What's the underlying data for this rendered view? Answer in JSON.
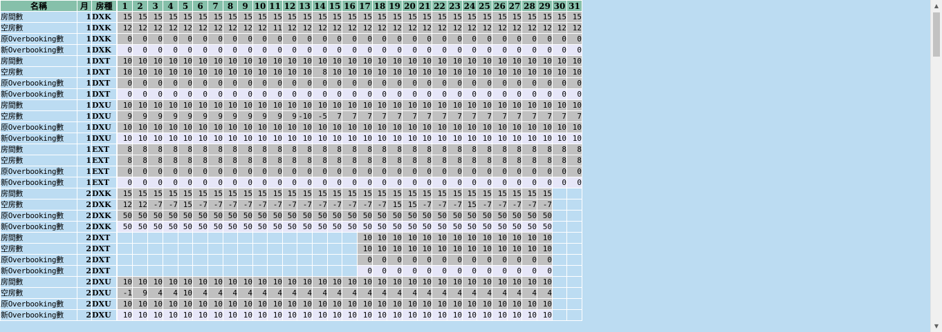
{
  "header": {
    "name": "名稱",
    "month": "月",
    "room": "房種",
    "days": [
      "1",
      "2",
      "3",
      "4",
      "5",
      "6",
      "7",
      "8",
      "9",
      "10",
      "11",
      "12",
      "13",
      "14",
      "15",
      "16",
      "17",
      "18",
      "19",
      "20",
      "21",
      "22",
      "23",
      "24",
      "25",
      "26",
      "27",
      "28",
      "29",
      "30",
      "31"
    ]
  },
  "rows": [
    {
      "name": "房間數",
      "month": "1",
      "room": "DXK",
      "values": [
        "15",
        "15",
        "15",
        "15",
        "15",
        "15",
        "15",
        "15",
        "15",
        "15",
        "15",
        "15",
        "15",
        "15",
        "15",
        "15",
        "15",
        "15",
        "15",
        "15",
        "15",
        "15",
        "15",
        "15",
        "15",
        "15",
        "15",
        "15",
        "15",
        "15",
        "15"
      ]
    },
    {
      "name": "空房數",
      "month": "1",
      "room": "DXK",
      "values": [
        "12",
        "12",
        "12",
        "12",
        "12",
        "12",
        "12",
        "12",
        "12",
        "12",
        "11",
        "12",
        "12",
        "12",
        "12",
        "12",
        "12",
        "12",
        "12",
        "12",
        "12",
        "12",
        "12",
        "12",
        "12",
        "12",
        "12",
        "12",
        "12",
        "12",
        "12"
      ]
    },
    {
      "name": "原Overbooking數",
      "month": "1",
      "room": "DXK",
      "values": [
        "0",
        "0",
        "0",
        "0",
        "0",
        "0",
        "0",
        "0",
        "0",
        "0",
        "0",
        "0",
        "0",
        "0",
        "0",
        "0",
        "0",
        "0",
        "0",
        "0",
        "0",
        "0",
        "0",
        "0",
        "0",
        "0",
        "0",
        "0",
        "0",
        "0",
        "0"
      ]
    },
    {
      "name": "新Overbooking數",
      "month": "1",
      "room": "DXK",
      "values": [
        "0",
        "0",
        "0",
        "0",
        "0",
        "0",
        "0",
        "0",
        "0",
        "0",
        "0",
        "0",
        "0",
        "0",
        "0",
        "0",
        "0",
        "0",
        "0",
        "0",
        "0",
        "0",
        "0",
        "0",
        "0",
        "0",
        "0",
        "0",
        "0",
        "0",
        "0"
      ]
    },
    {
      "name": "房間數",
      "month": "1",
      "room": "DXT",
      "values": [
        "10",
        "10",
        "10",
        "10",
        "10",
        "10",
        "10",
        "10",
        "10",
        "10",
        "10",
        "10",
        "10",
        "10",
        "10",
        "10",
        "10",
        "10",
        "10",
        "10",
        "10",
        "10",
        "10",
        "10",
        "10",
        "10",
        "10",
        "10",
        "10",
        "10",
        "10"
      ]
    },
    {
      "name": "空房數",
      "month": "1",
      "room": "DXT",
      "values": [
        "10",
        "10",
        "10",
        "10",
        "10",
        "10",
        "10",
        "10",
        "10",
        "10",
        "10",
        "10",
        "10",
        "8",
        "10",
        "10",
        "10",
        "10",
        "10",
        "10",
        "10",
        "10",
        "10",
        "10",
        "10",
        "10",
        "10",
        "10",
        "10",
        "10",
        "10"
      ]
    },
    {
      "name": "原Overbooking數",
      "month": "1",
      "room": "DXT",
      "values": [
        "0",
        "0",
        "0",
        "0",
        "0",
        "0",
        "0",
        "0",
        "0",
        "0",
        "0",
        "0",
        "0",
        "0",
        "0",
        "0",
        "0",
        "0",
        "0",
        "0",
        "0",
        "0",
        "0",
        "0",
        "0",
        "0",
        "0",
        "0",
        "0",
        "0",
        "0"
      ]
    },
    {
      "name": "新Overbooking數",
      "month": "1",
      "room": "DXT",
      "values": [
        "0",
        "0",
        "0",
        "0",
        "0",
        "0",
        "0",
        "0",
        "0",
        "0",
        "0",
        "0",
        "0",
        "0",
        "0",
        "0",
        "0",
        "0",
        "0",
        "0",
        "0",
        "0",
        "0",
        "0",
        "0",
        "0",
        "0",
        "0",
        "0",
        "0",
        "0"
      ]
    },
    {
      "name": "房間數",
      "month": "1",
      "room": "DXU",
      "values": [
        "10",
        "10",
        "10",
        "10",
        "10",
        "10",
        "10",
        "10",
        "10",
        "10",
        "10",
        "10",
        "10",
        "10",
        "10",
        "10",
        "10",
        "10",
        "10",
        "10",
        "10",
        "10",
        "10",
        "10",
        "10",
        "10",
        "10",
        "10",
        "10",
        "10",
        "10"
      ]
    },
    {
      "name": "空房數",
      "month": "1",
      "room": "DXU",
      "values": [
        "9",
        "9",
        "9",
        "9",
        "9",
        "9",
        "9",
        "9",
        "9",
        "9",
        "9",
        "9",
        "-10",
        "-5",
        "7",
        "7",
        "7",
        "7",
        "7",
        "7",
        "7",
        "7",
        "7",
        "7",
        "7",
        "7",
        "7",
        "7",
        "7",
        "7",
        "7"
      ]
    },
    {
      "name": "原Overbooking數",
      "month": "1",
      "room": "DXU",
      "values": [
        "10",
        "10",
        "10",
        "10",
        "10",
        "10",
        "10",
        "10",
        "10",
        "10",
        "10",
        "10",
        "10",
        "10",
        "10",
        "10",
        "10",
        "10",
        "10",
        "10",
        "10",
        "10",
        "10",
        "10",
        "10",
        "10",
        "10",
        "10",
        "10",
        "10",
        "10"
      ]
    },
    {
      "name": "新Overbooking數",
      "month": "1",
      "room": "DXU",
      "values": [
        "10",
        "10",
        "10",
        "10",
        "10",
        "10",
        "10",
        "10",
        "10",
        "10",
        "10",
        "10",
        "10",
        "10",
        "10",
        "10",
        "10",
        "10",
        "10",
        "10",
        "10",
        "10",
        "10",
        "10",
        "10",
        "10",
        "10",
        "10",
        "10",
        "10",
        "10"
      ]
    },
    {
      "name": "房間數",
      "month": "1",
      "room": "EXT",
      "values": [
        "8",
        "8",
        "8",
        "8",
        "8",
        "8",
        "8",
        "8",
        "8",
        "8",
        "8",
        "8",
        "8",
        "8",
        "8",
        "8",
        "8",
        "8",
        "8",
        "8",
        "8",
        "8",
        "8",
        "8",
        "8",
        "8",
        "8",
        "8",
        "8",
        "8",
        "8"
      ]
    },
    {
      "name": "空房數",
      "month": "1",
      "room": "EXT",
      "values": [
        "8",
        "8",
        "8",
        "8",
        "8",
        "8",
        "8",
        "8",
        "8",
        "8",
        "8",
        "8",
        "8",
        "8",
        "8",
        "8",
        "8",
        "8",
        "8",
        "8",
        "8",
        "8",
        "8",
        "8",
        "8",
        "8",
        "8",
        "8",
        "8",
        "8",
        "8"
      ]
    },
    {
      "name": "原Overbooking數",
      "month": "1",
      "room": "EXT",
      "values": [
        "0",
        "0",
        "0",
        "0",
        "0",
        "0",
        "0",
        "0",
        "0",
        "0",
        "0",
        "0",
        "0",
        "0",
        "0",
        "0",
        "0",
        "0",
        "0",
        "0",
        "0",
        "0",
        "0",
        "0",
        "0",
        "0",
        "0",
        "0",
        "0",
        "0",
        "0"
      ]
    },
    {
      "name": "新Overbooking數",
      "month": "1",
      "room": "EXT",
      "values": [
        "0",
        "0",
        "0",
        "0",
        "0",
        "0",
        "0",
        "0",
        "0",
        "0",
        "0",
        "0",
        "0",
        "0",
        "0",
        "0",
        "0",
        "0",
        "0",
        "0",
        "0",
        "0",
        "0",
        "0",
        "0",
        "0",
        "0",
        "0",
        "0",
        "0",
        "0"
      ]
    },
    {
      "name": "房間數",
      "month": "2",
      "room": "DXK",
      "values": [
        "15",
        "15",
        "15",
        "15",
        "15",
        "15",
        "15",
        "15",
        "15",
        "15",
        "15",
        "15",
        "15",
        "15",
        "15",
        "15",
        "15",
        "15",
        "15",
        "15",
        "15",
        "15",
        "15",
        "15",
        "15",
        "15",
        "15",
        "15",
        "15",
        "",
        ""
      ]
    },
    {
      "name": "空房數",
      "month": "2",
      "room": "DXK",
      "values": [
        "12",
        "12",
        "-7",
        "-7",
        "15",
        "-7",
        "-7",
        "-7",
        "-7",
        "-7",
        "-7",
        "-7",
        "-7",
        "-7",
        "-7",
        "-7",
        "-7",
        "-7",
        "15",
        "15",
        "-7",
        "-7",
        "-7",
        "15",
        "-7",
        "-7",
        "-7",
        "-7",
        "-7",
        "",
        ""
      ]
    },
    {
      "name": "原Overbooking數",
      "month": "2",
      "room": "DXK",
      "values": [
        "50",
        "50",
        "50",
        "50",
        "50",
        "50",
        "50",
        "50",
        "50",
        "50",
        "50",
        "50",
        "50",
        "50",
        "50",
        "50",
        "50",
        "50",
        "50",
        "50",
        "50",
        "50",
        "50",
        "50",
        "50",
        "50",
        "50",
        "50",
        "50",
        "",
        ""
      ]
    },
    {
      "name": "新Overbooking數",
      "month": "2",
      "room": "DXK",
      "values": [
        "50",
        "50",
        "50",
        "50",
        "50",
        "50",
        "50",
        "50",
        "50",
        "50",
        "50",
        "50",
        "50",
        "50",
        "50",
        "50",
        "50",
        "50",
        "50",
        "50",
        "50",
        "50",
        "50",
        "50",
        "50",
        "50",
        "50",
        "50",
        "50",
        "",
        ""
      ]
    },
    {
      "name": "房間數",
      "month": "2",
      "room": "DXT",
      "values": [
        "",
        "",
        "",
        "",
        "",
        "",
        "",
        "",
        "",
        "",
        "",
        "",
        "",
        "",
        "",
        "",
        "10",
        "10",
        "10",
        "10",
        "10",
        "10",
        "10",
        "10",
        "10",
        "10",
        "10",
        "10",
        "10",
        "",
        ""
      ]
    },
    {
      "name": "空房數",
      "month": "2",
      "room": "DXT",
      "values": [
        "",
        "",
        "",
        "",
        "",
        "",
        "",
        "",
        "",
        "",
        "",
        "",
        "",
        "",
        "",
        "",
        "10",
        "10",
        "10",
        "10",
        "10",
        "10",
        "10",
        "10",
        "10",
        "10",
        "10",
        "10",
        "10",
        "",
        ""
      ]
    },
    {
      "name": "原Overbooking數",
      "month": "2",
      "room": "DXT",
      "values": [
        "",
        "",
        "",
        "",
        "",
        "",
        "",
        "",
        "",
        "",
        "",
        "",
        "",
        "",
        "",
        "",
        "0",
        "0",
        "0",
        "0",
        "0",
        "0",
        "0",
        "0",
        "0",
        "0",
        "0",
        "0",
        "0",
        "",
        ""
      ]
    },
    {
      "name": "新Overbooking數",
      "month": "2",
      "room": "DXT",
      "values": [
        "",
        "",
        "",
        "",
        "",
        "",
        "",
        "",
        "",
        "",
        "",
        "",
        "",
        "",
        "",
        "",
        "0",
        "0",
        "0",
        "0",
        "0",
        "0",
        "0",
        "0",
        "0",
        "0",
        "0",
        "0",
        "0",
        "",
        ""
      ]
    },
    {
      "name": "房間數",
      "month": "2",
      "room": "DXU",
      "values": [
        "10",
        "10",
        "10",
        "10",
        "10",
        "10",
        "10",
        "10",
        "10",
        "10",
        "10",
        "10",
        "10",
        "10",
        "10",
        "10",
        "10",
        "10",
        "10",
        "10",
        "10",
        "10",
        "10",
        "10",
        "10",
        "10",
        "10",
        "10",
        "10",
        "",
        ""
      ]
    },
    {
      "name": "空房數",
      "month": "2",
      "room": "DXU",
      "values": [
        "-1",
        "9",
        "4",
        "4",
        "10",
        "4",
        "4",
        "4",
        "4",
        "4",
        "4",
        "4",
        "4",
        "4",
        "4",
        "4",
        "4",
        "4",
        "4",
        "4",
        "4",
        "4",
        "4",
        "4",
        "4",
        "4",
        "4",
        "4",
        "4",
        "",
        ""
      ]
    },
    {
      "name": "原Overbooking數",
      "month": "2",
      "room": "DXU",
      "values": [
        "10",
        "10",
        "10",
        "10",
        "10",
        "10",
        "10",
        "10",
        "10",
        "10",
        "10",
        "10",
        "10",
        "10",
        "10",
        "10",
        "10",
        "10",
        "10",
        "10",
        "10",
        "10",
        "10",
        "10",
        "10",
        "10",
        "10",
        "10",
        "10",
        "",
        ""
      ]
    },
    {
      "name": "新Overbooking數",
      "month": "2",
      "room": "DXU",
      "values": [
        "10",
        "10",
        "10",
        "10",
        "10",
        "10",
        "10",
        "10",
        "10",
        "10",
        "10",
        "10",
        "10",
        "10",
        "10",
        "10",
        "10",
        "10",
        "10",
        "10",
        "10",
        "10",
        "10",
        "10",
        "10",
        "10",
        "10",
        "10",
        "10",
        "",
        ""
      ]
    }
  ],
  "colors": {
    "header_bg": "#86c0aa",
    "label_bg": "#bcdcf2",
    "cell_gray": "#c0c0c0",
    "cell_white": "#e6e6f8"
  },
  "scrollbar": {
    "up_icon": "scroll-up-arrow-icon",
    "down_icon": "scroll-down-arrow-icon"
  }
}
